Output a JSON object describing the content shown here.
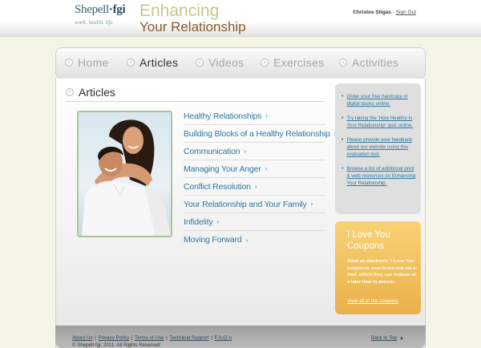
{
  "header": {
    "logo_brand": "Shepell",
    "logo_brand_suffix": "·fgi",
    "logo_tagline": "work. health. life.",
    "title_line1": "Enhancing",
    "title_line2": "Your Relationship",
    "user_name": "Christos Stigas",
    "separator": "-",
    "signout_label": "Sign Out"
  },
  "nav": {
    "items": [
      {
        "label": "Home"
      },
      {
        "label": "Articles"
      },
      {
        "label": "Videos"
      },
      {
        "label": "Exercises"
      },
      {
        "label": "Activities"
      }
    ],
    "active": "Articles"
  },
  "main": {
    "section_title": "Articles",
    "articles": [
      {
        "label": "Healthy Relationships"
      },
      {
        "label": "Building Blocks of a Healthy Relationship"
      },
      {
        "label": "Communication"
      },
      {
        "label": "Managing Your Anger"
      },
      {
        "label": "Conflict Resolution"
      },
      {
        "label": "Your Relationship and Your Family"
      },
      {
        "label": "Infidelity"
      },
      {
        "label": "Moving Forward"
      }
    ],
    "arrow_glyph": "›"
  },
  "sidebar": {
    "links": [
      {
        "label": "Order your free hardcopy or digital books online."
      },
      {
        "label": "Try taking the 'How Healthy Is Your Relationship' quiz online."
      },
      {
        "label": "Please provide your feedback about our website using this evaluation tool."
      },
      {
        "label": "Browse a list of additional print & web resources on Enhancing Your Relationship."
      }
    ],
    "coupon": {
      "title": "I Love You Coupons",
      "description": "Send an electronic 'I Love You' coupon to your loved one via e-mail, which they can redeem at a later time in person.",
      "link_label": "View all of the coupons"
    }
  },
  "footer": {
    "links": [
      "About Us",
      "Privacy Policy",
      "Terms of Use",
      "Technical Support",
      "F.A.Q.'s"
    ],
    "separator": "|",
    "copyright": "© Shepell·fgi, 2011. All Rights Reserved",
    "back_to_top": "Back to Top"
  },
  "colors": {
    "accent_blue": "#2f78a0",
    "coupon_orange": "#ebb04a",
    "photo_border": "#a7c79a",
    "page_background": "#f5f5e6"
  },
  "icons": {
    "nav_bullet": "circle-arrow-icon",
    "article_arrow": "chevron-right-icon",
    "back_to_top_arrow": "triangle-up-icon"
  }
}
